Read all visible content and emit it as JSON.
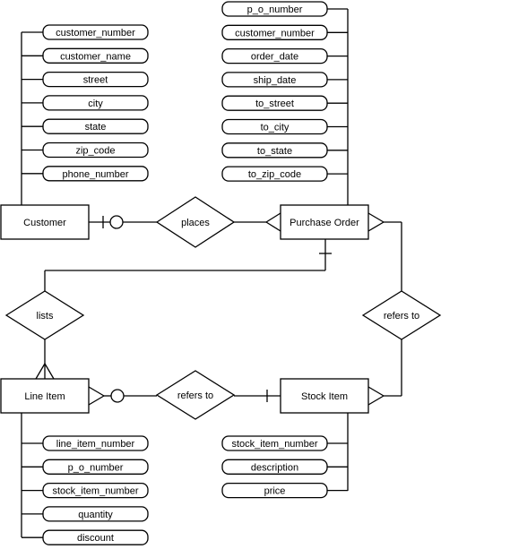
{
  "entities": {
    "customer": {
      "label": "Customer",
      "attributes": [
        "customer_number",
        "customer_name",
        "street",
        "city",
        "state",
        "zip_code",
        "phone_number"
      ]
    },
    "purchase_order": {
      "label": "Purchase Order",
      "attributes": [
        "p_o_number",
        "customer_number",
        "order_date",
        "ship_date",
        "to_street",
        "to_city",
        "to_state",
        "to_zip_code"
      ]
    },
    "line_item": {
      "label": "Line Item",
      "attributes": [
        "line_item_number",
        "p_o_number",
        "stock_item_number",
        "quantity",
        "discount"
      ]
    },
    "stock_item": {
      "label": "Stock Item",
      "attributes": [
        "stock_item_number",
        "description",
        "price"
      ]
    }
  },
  "relationships": {
    "places": {
      "label": "places",
      "from": "Customer",
      "to": "Purchase Order",
      "from_cardinality": "one (optional)",
      "to_cardinality": "many"
    },
    "lists": {
      "label": "lists",
      "from": "Purchase Order",
      "to": "Line Item",
      "from_cardinality": "one",
      "to_cardinality": "many"
    },
    "refers_to_li": {
      "label": "refers to",
      "from": "Line Item",
      "to": "Stock Item",
      "from_cardinality": "many (optional)",
      "to_cardinality": "one"
    },
    "refers_to_po": {
      "label": "refers to",
      "from": "Purchase Order",
      "to": "Stock Item",
      "from_cardinality": "many",
      "to_cardinality": "many"
    }
  }
}
